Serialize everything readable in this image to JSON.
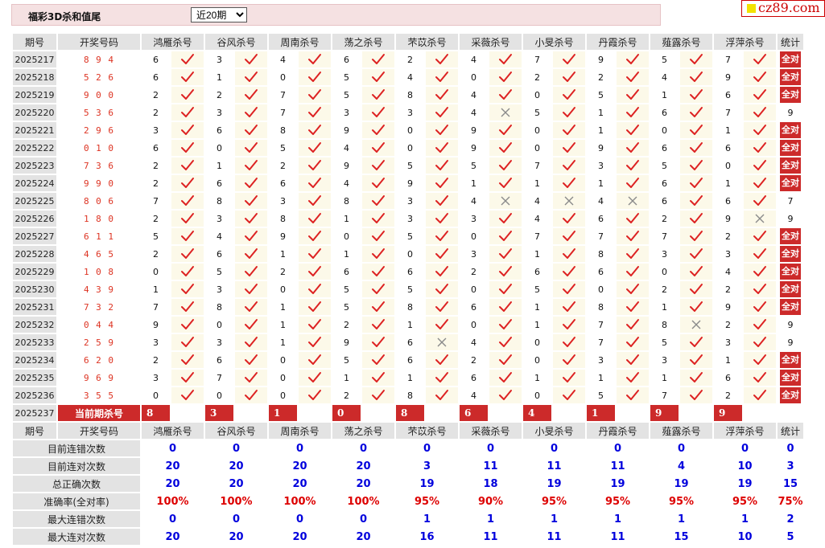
{
  "header": {
    "title": "福彩3D杀和值尾",
    "select_value": "近20期",
    "select_options": [
      "近20期"
    ]
  },
  "logo": {
    "text": "cz89.com"
  },
  "table": {
    "col_period": "期号",
    "col_number": "开奖号码",
    "col_stat": "统计",
    "experts": [
      "鸿雁杀号",
      "谷风杀号",
      "周南杀号",
      "荡之杀号",
      "芣苡杀号",
      "采薇杀号",
      "小旻杀号",
      "丹霞杀号",
      "薤露杀号",
      "浮萍杀号"
    ],
    "full_label": "全对",
    "rows": [
      {
        "period": "2025217",
        "number": "8 9 4",
        "kills": [
          "6",
          "3",
          "4",
          "6",
          "2",
          "4",
          "7",
          "9",
          "5",
          "7"
        ],
        "marks": [
          1,
          1,
          1,
          1,
          1,
          1,
          1,
          1,
          1,
          1
        ],
        "stat": "全对"
      },
      {
        "period": "2025218",
        "number": "5 2 6",
        "kills": [
          "6",
          "1",
          "0",
          "5",
          "4",
          "0",
          "2",
          "2",
          "4",
          "9"
        ],
        "marks": [
          1,
          1,
          1,
          1,
          1,
          1,
          1,
          1,
          1,
          1
        ],
        "stat": "全对"
      },
      {
        "period": "2025219",
        "number": "9 0 0",
        "kills": [
          "2",
          "2",
          "7",
          "5",
          "8",
          "4",
          "0",
          "5",
          "1",
          "6"
        ],
        "marks": [
          1,
          1,
          1,
          1,
          1,
          1,
          1,
          1,
          1,
          1
        ],
        "stat": "全对"
      },
      {
        "period": "2025220",
        "number": "5 3 6",
        "kills": [
          "2",
          "3",
          "7",
          "3",
          "3",
          "4",
          "5",
          "1",
          "6",
          "7"
        ],
        "marks": [
          1,
          1,
          1,
          1,
          1,
          0,
          1,
          1,
          1,
          1
        ],
        "stat": "9"
      },
      {
        "period": "2025221",
        "number": "2 9 6",
        "kills": [
          "3",
          "6",
          "8",
          "9",
          "0",
          "9",
          "0",
          "1",
          "0",
          "1"
        ],
        "marks": [
          1,
          1,
          1,
          1,
          1,
          1,
          1,
          1,
          1,
          1
        ],
        "stat": "全对"
      },
      {
        "period": "2025222",
        "number": "0 1 0",
        "kills": [
          "6",
          "0",
          "5",
          "4",
          "0",
          "9",
          "0",
          "9",
          "6",
          "6"
        ],
        "marks": [
          1,
          1,
          1,
          1,
          1,
          1,
          1,
          1,
          1,
          1
        ],
        "stat": "全对"
      },
      {
        "period": "2025223",
        "number": "7 3 6",
        "kills": [
          "2",
          "1",
          "2",
          "9",
          "5",
          "5",
          "7",
          "3",
          "5",
          "0"
        ],
        "marks": [
          1,
          1,
          1,
          1,
          1,
          1,
          1,
          1,
          1,
          1
        ],
        "stat": "全对"
      },
      {
        "period": "2025224",
        "number": "9 9 0",
        "kills": [
          "2",
          "6",
          "6",
          "4",
          "9",
          "1",
          "1",
          "1",
          "6",
          "1"
        ],
        "marks": [
          1,
          1,
          1,
          1,
          1,
          1,
          1,
          1,
          1,
          1
        ],
        "stat": "全对"
      },
      {
        "period": "2025225",
        "number": "8 0 6",
        "kills": [
          "7",
          "8",
          "3",
          "8",
          "3",
          "4",
          "4",
          "4",
          "6",
          "6"
        ],
        "marks": [
          1,
          1,
          1,
          1,
          1,
          0,
          0,
          0,
          1,
          1
        ],
        "stat": "7"
      },
      {
        "period": "2025226",
        "number": "1 8 0",
        "kills": [
          "2",
          "3",
          "8",
          "1",
          "3",
          "3",
          "4",
          "6",
          "2",
          "9"
        ],
        "marks": [
          1,
          1,
          1,
          1,
          1,
          1,
          1,
          1,
          1,
          0
        ],
        "stat": "9"
      },
      {
        "period": "2025227",
        "number": "6 1 1",
        "kills": [
          "5",
          "4",
          "9",
          "0",
          "5",
          "0",
          "7",
          "7",
          "7",
          "2"
        ],
        "marks": [
          1,
          1,
          1,
          1,
          1,
          1,
          1,
          1,
          1,
          1
        ],
        "stat": "全对"
      },
      {
        "period": "2025228",
        "number": "4 6 5",
        "kills": [
          "2",
          "6",
          "1",
          "1",
          "0",
          "3",
          "1",
          "8",
          "3",
          "3"
        ],
        "marks": [
          1,
          1,
          1,
          1,
          1,
          1,
          1,
          1,
          1,
          1
        ],
        "stat": "全对"
      },
      {
        "period": "2025229",
        "number": "1 0 8",
        "kills": [
          "0",
          "5",
          "2",
          "6",
          "6",
          "2",
          "6",
          "6",
          "0",
          "4"
        ],
        "marks": [
          1,
          1,
          1,
          1,
          1,
          1,
          1,
          1,
          1,
          1
        ],
        "stat": "全对"
      },
      {
        "period": "2025230",
        "number": "4 3 9",
        "kills": [
          "1",
          "3",
          "0",
          "5",
          "5",
          "0",
          "5",
          "0",
          "2",
          "2"
        ],
        "marks": [
          1,
          1,
          1,
          1,
          1,
          1,
          1,
          1,
          1,
          1
        ],
        "stat": "全对"
      },
      {
        "period": "2025231",
        "number": "7 3 2",
        "kills": [
          "7",
          "8",
          "1",
          "5",
          "8",
          "6",
          "1",
          "8",
          "1",
          "9"
        ],
        "marks": [
          1,
          1,
          1,
          1,
          1,
          1,
          1,
          1,
          1,
          1
        ],
        "stat": "全对"
      },
      {
        "period": "2025232",
        "number": "0 4 4",
        "kills": [
          "9",
          "0",
          "1",
          "2",
          "1",
          "0",
          "1",
          "7",
          "8",
          "2"
        ],
        "marks": [
          1,
          1,
          1,
          1,
          1,
          1,
          1,
          1,
          0,
          1
        ],
        "stat": "9"
      },
      {
        "period": "2025233",
        "number": "2 5 9",
        "kills": [
          "3",
          "3",
          "1",
          "9",
          "6",
          "4",
          "0",
          "7",
          "5",
          "3"
        ],
        "marks": [
          1,
          1,
          1,
          1,
          0,
          1,
          1,
          1,
          1,
          1
        ],
        "stat": "9"
      },
      {
        "period": "2025234",
        "number": "6 2 0",
        "kills": [
          "2",
          "6",
          "0",
          "5",
          "6",
          "2",
          "0",
          "3",
          "3",
          "1"
        ],
        "marks": [
          1,
          1,
          1,
          1,
          1,
          1,
          1,
          1,
          1,
          1
        ],
        "stat": "全对"
      },
      {
        "period": "2025235",
        "number": "9 6 9",
        "kills": [
          "3",
          "7",
          "0",
          "1",
          "1",
          "6",
          "1",
          "1",
          "1",
          "6"
        ],
        "marks": [
          1,
          1,
          1,
          1,
          1,
          1,
          1,
          1,
          1,
          1
        ],
        "stat": "全对"
      },
      {
        "period": "2025236",
        "number": "3 5 5",
        "kills": [
          "0",
          "0",
          "0",
          "2",
          "8",
          "4",
          "0",
          "5",
          "7",
          "2"
        ],
        "marks": [
          1,
          1,
          1,
          1,
          1,
          1,
          1,
          1,
          1,
          1
        ],
        "stat": "全对"
      }
    ],
    "current": {
      "period": "2025237",
      "label": "当前期杀号",
      "kills": [
        "8",
        "3",
        "1",
        "0",
        "8",
        "6",
        "4",
        "1",
        "9",
        "9"
      ]
    }
  },
  "summary": {
    "rows": [
      {
        "label": "目前连错次数",
        "values": [
          "0",
          "0",
          "0",
          "0",
          "0",
          "0",
          "0",
          "0",
          "0",
          "0",
          "0"
        ],
        "red": false
      },
      {
        "label": "目前连对次数",
        "values": [
          "20",
          "20",
          "20",
          "20",
          "3",
          "11",
          "11",
          "11",
          "4",
          "10",
          "3"
        ],
        "red": false
      },
      {
        "label": "总正确次数",
        "values": [
          "20",
          "20",
          "20",
          "20",
          "19",
          "18",
          "19",
          "19",
          "19",
          "19",
          "15"
        ],
        "red": false
      },
      {
        "label": "准确率(全对率)",
        "values": [
          "100%",
          "100%",
          "100%",
          "100%",
          "95%",
          "90%",
          "95%",
          "95%",
          "95%",
          "95%",
          "75%"
        ],
        "red": true
      },
      {
        "label": "最大连错次数",
        "values": [
          "0",
          "0",
          "0",
          "0",
          "1",
          "1",
          "1",
          "1",
          "1",
          "1",
          "2"
        ],
        "red": false
      },
      {
        "label": "最大连对次数",
        "values": [
          "20",
          "20",
          "20",
          "20",
          "16",
          "11",
          "11",
          "11",
          "15",
          "10",
          "5"
        ],
        "red": false
      }
    ]
  },
  "colors": {
    "check": "#dd2222",
    "cross": "#8a8a8a",
    "accent": "#cc2a2a",
    "blue": "#0000dd",
    "mark_bg": "#fcf9e9"
  }
}
